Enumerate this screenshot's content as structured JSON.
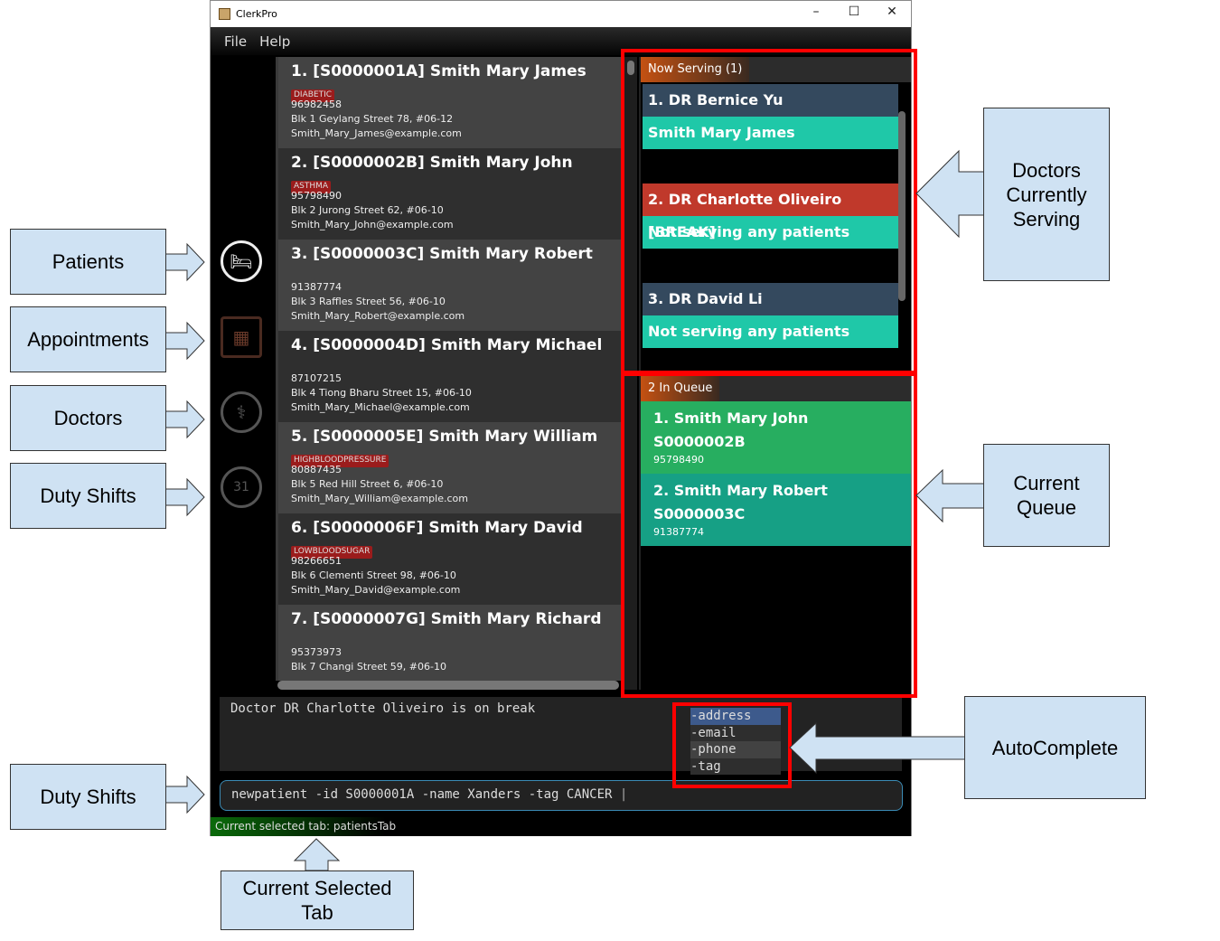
{
  "window": {
    "title": "ClerkPro",
    "controls": [
      "minimize",
      "maximize",
      "close"
    ]
  },
  "menu": [
    "File",
    "Help"
  ],
  "sidebar": [
    {
      "name": "patients",
      "icon": "bed-icon",
      "active": true
    },
    {
      "name": "appointments",
      "icon": "calendar-icon"
    },
    {
      "name": "doctors",
      "icon": "doctor-icon"
    },
    {
      "name": "duty-shifts",
      "icon": "calendar-31-icon"
    }
  ],
  "patients": [
    {
      "title": "1.  [S0000001A]  Smith Mary James",
      "tag": "DIABETIC",
      "phone": "96982458",
      "address": "Blk 1 Geylang Street 78, #06-12",
      "email": "Smith_Mary_James@example.com"
    },
    {
      "title": "2.  [S0000002B]  Smith Mary John",
      "tag": "ASTHMA",
      "phone": "95798490",
      "address": "Blk 2 Jurong Street 62, #06-10",
      "email": "Smith_Mary_John@example.com"
    },
    {
      "title": "3.  [S0000003C]  Smith Mary Robert",
      "tag": "",
      "phone": "91387774",
      "address": "Blk 3 Raffles Street 56, #06-10",
      "email": "Smith_Mary_Robert@example.com"
    },
    {
      "title": "4.  [S0000004D]  Smith Mary Michael",
      "tag": "",
      "phone": "87107215",
      "address": "Blk 4 Tiong Bharu Street 15, #06-10",
      "email": "Smith_Mary_Michael@example.com"
    },
    {
      "title": "5.  [S0000005E]  Smith Mary William",
      "tag": "HIGHBLOODPRESSURE",
      "phone": "80887435",
      "address": "Blk 5 Red Hill Street 6, #06-10",
      "email": "Smith_Mary_William@example.com"
    },
    {
      "title": "6.  [S0000006F]  Smith Mary David",
      "tag": "LOWBLOODSUGAR",
      "phone": "98266651",
      "address": "Blk 6 Clementi Street 98, #06-10",
      "email": "Smith_Mary_David@example.com"
    },
    {
      "title": "7.  [S0000007G]  Smith Mary Richard",
      "tag": "",
      "phone": "95373973",
      "address": "Blk 7 Changi Street 59, #06-10",
      "email": ""
    }
  ],
  "now_serving": {
    "header": "Now Serving (1)",
    "doctors": [
      {
        "name": "1. DR Bernice Yu",
        "patient": "Smith Mary James",
        "on_break": false
      },
      {
        "name": "2. DR Charlotte Oliveiro [BREAK]",
        "patient": "Not serving any patients",
        "on_break": true
      },
      {
        "name": "3. DR David Li",
        "patient": "Not serving any patients",
        "on_break": false
      }
    ]
  },
  "queue": {
    "header": "2 In Queue",
    "items": [
      {
        "name": "1.  Smith Mary John",
        "id": "S0000002B",
        "phone": "95798490",
        "color": "#27ae60"
      },
      {
        "name": "2.  Smith Mary Robert",
        "id": "S0000003C",
        "phone": "91387774",
        "color": "#16a085"
      }
    ]
  },
  "result_text": "Doctor DR Charlotte Oliveiro is on break",
  "autocomplete": [
    "-address",
    "-email",
    "-phone",
    "-tag"
  ],
  "command_value": "newpatient -id S0000001A -name Xanders -tag CANCER",
  "status": "Current selected tab: patientsTab",
  "annotations": {
    "patients": "Patients",
    "appointments": "Appointments",
    "doctors": "Doctors",
    "duty_shifts": "Duty Shifts",
    "duty_shifts_2": "Duty Shifts",
    "doctors_serving": "Doctors Currently Serving",
    "current_queue": "Current Queue",
    "autocomplete": "AutoComplete",
    "current_tab": "Current Selected Tab"
  },
  "colors": {
    "highlight": "#ff0000",
    "callout": "#cfe2f3",
    "serving_patient": "#1fc8a8",
    "break": "#c0392b"
  }
}
